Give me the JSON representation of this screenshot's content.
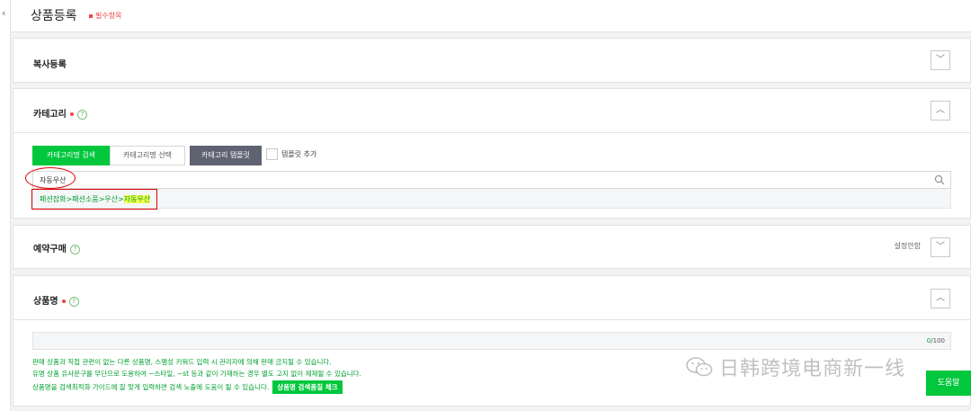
{
  "sidebar": {
    "collapse_glyph": "‹"
  },
  "header": {
    "title": "상품등록",
    "required_note": "필수항목"
  },
  "copy_register": {
    "title": "복사등록",
    "toggle_glyph": "﹀"
  },
  "category": {
    "title": "카테고리",
    "help_glyph": "?",
    "toggle_glyph": "︿",
    "tabs": [
      "카테고리명 검색",
      "카테고리명 선택",
      "카테고리 템플릿"
    ],
    "template_add_label": "템플릿 추가",
    "search_value": "자동우산",
    "result_path_prefix": "패션잡화>패션소품>우산>",
    "result_path_match": "자동우산"
  },
  "preorder": {
    "title": "예약구매",
    "help_glyph": "?",
    "settings_label": "설정안함",
    "toggle_glyph": "﹀"
  },
  "product_name": {
    "title": "상품명",
    "help_glyph": "?",
    "toggle_glyph": "︿",
    "char_count": "0",
    "char_max": "/100",
    "hints": [
      "판매 상품과 직접 관련이 없는 다른 상품명, 스팸성 키워드 입력 시 관리자에 의해 판매 금지될 수 있습니다.",
      "유명 상품 유사문구를 무단으로 도용하여 ~스타일, ~st 등과 같이 기재하는 경우 별도 고지 없이 제재될 수 있습니다.",
      "상품명을 검색최적화 가이드에 잘 맞게 입력하면 검색 노출에 도움이 될 수 있습니다."
    ],
    "check_button_label": "상품명 검색품질 체크"
  },
  "help_button_label": "도움말",
  "watermark_text": "日韩跨境电商新一线",
  "colors": {
    "accent": "#00c73c",
    "required": "#f24141",
    "annotation": "#e00000",
    "template_btn": "#5e6271"
  }
}
